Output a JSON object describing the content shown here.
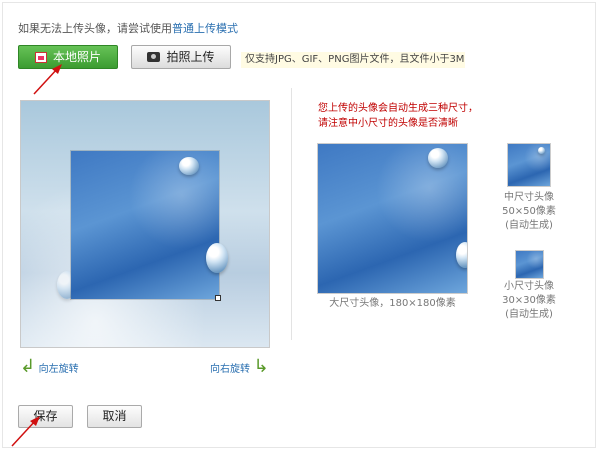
{
  "hint": {
    "text": "如果无法上传头像，请尝试使用",
    "link": "普通上传模式"
  },
  "toolbar": {
    "local_photo_label": "本地照片",
    "take_photo_label": "拍照上传",
    "note": "仅支持JPG、GIF、PNG图片文件，且文件小于3M"
  },
  "editor": {
    "rotate_left_label": "向左旋转",
    "rotate_right_label": "向右旋转"
  },
  "preview": {
    "warning_line1": "您上传的头像会自动生成三种尺寸，",
    "warning_line2": "请注意中小尺寸的头像是否清晰",
    "large_caption": "大尺寸头像，180×180像素",
    "medium_caption_1": "中尺寸头像",
    "medium_caption_2": "50×50像素",
    "medium_caption_3": "(自动生成)",
    "small_caption_1": "小尺寸头像",
    "small_caption_2": "30×30像素",
    "small_caption_3": "(自动生成)"
  },
  "actions": {
    "save_label": "保存",
    "cancel_label": "取消"
  },
  "colors": {
    "primary_green": "#3c9c31",
    "link_blue": "#2a6fb0",
    "warning_red": "#c00000",
    "annotation_red": "#d01010"
  }
}
